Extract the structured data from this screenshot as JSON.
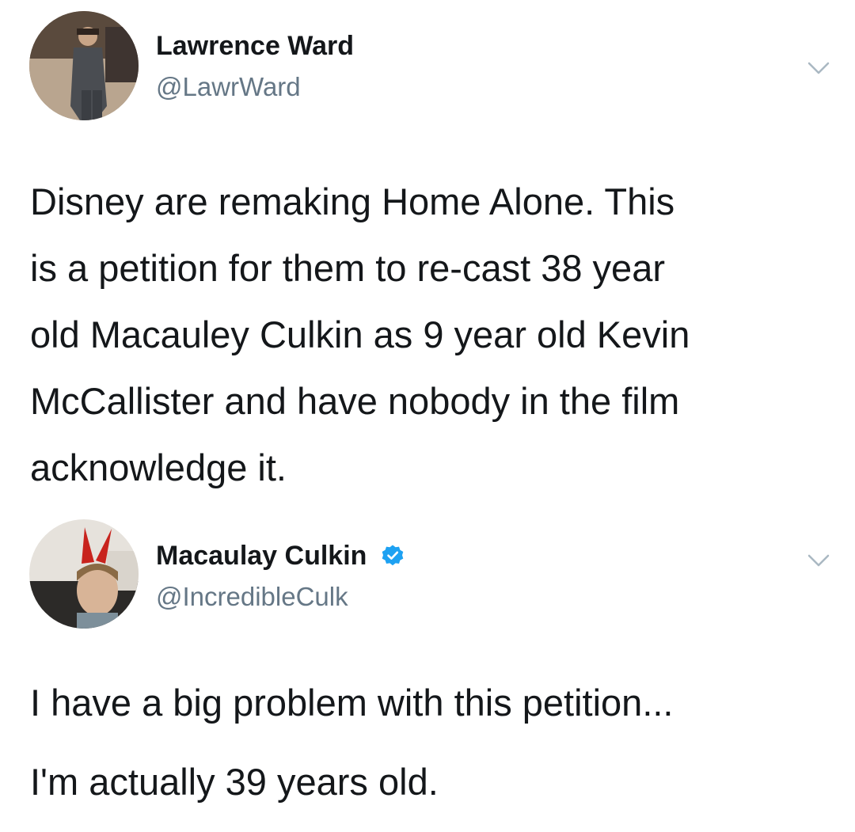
{
  "tweets": [
    {
      "display_name": "Lawrence Ward",
      "handle": "@LawrWard",
      "verified": false,
      "text_lines": [
        "Disney are remaking Home Alone. This",
        "is a petition for them to re-cast 38 year",
        "old Macauley Culkin as 9 year old Kevin",
        "McCallister and have nobody in the film",
        "acknowledge it."
      ]
    },
    {
      "display_name": "Macaulay Culkin",
      "handle": "@IncredibleCulk",
      "verified": true,
      "text_lines": [
        "I have a big problem with this petition...",
        "I'm actually 39 years old."
      ]
    }
  ],
  "icons": {
    "menu": "chevron-down-icon",
    "verified": "verified-badge-icon"
  },
  "colors": {
    "text": "#14171a",
    "secondary": "#657786",
    "verified_blue": "#1da1f2",
    "chevron": "#aab8c2"
  }
}
